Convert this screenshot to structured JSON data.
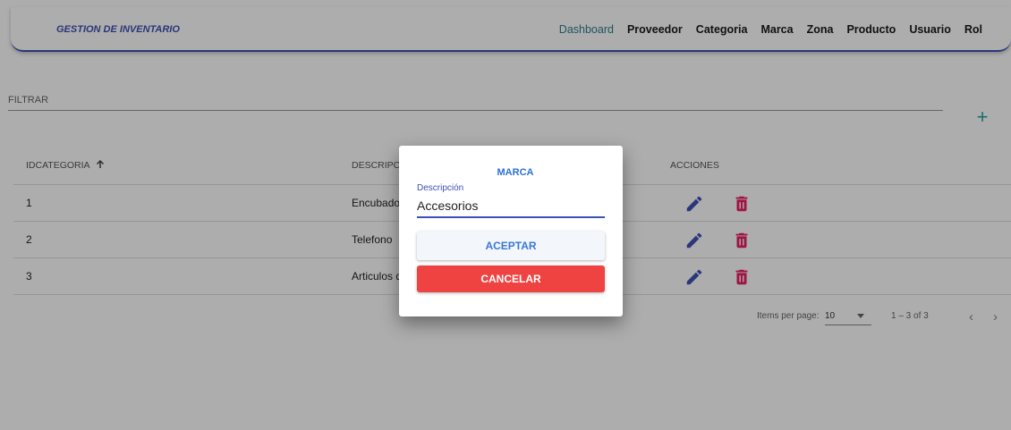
{
  "header": {
    "brand": "GESTION DE INVENTARIO",
    "nav": [
      "Dashboard",
      "Proveedor",
      "Categoria",
      "Marca",
      "Zona",
      "Producto",
      "Usuario",
      "Rol"
    ],
    "active": "Dashboard"
  },
  "filter": {
    "label": "FILTRAR"
  },
  "add_icon": "plus-icon",
  "table": {
    "columns": [
      "IDCATEGORIA",
      "DESCRIPCION",
      "ACCIONES"
    ],
    "sort_icon": "arrow-up-icon",
    "rows": [
      {
        "id": "1",
        "descripcion": "Encubado"
      },
      {
        "id": "2",
        "descripcion": "Telefono"
      },
      {
        "id": "3",
        "descripcion": "Articulos d"
      }
    ],
    "edit_icon": "pencil-icon",
    "delete_icon": "trash-icon"
  },
  "paginator": {
    "items_label": "Items per page:",
    "page_size": "10",
    "range": "1 – 3 of 3"
  },
  "dialog": {
    "title": "MARCA",
    "field_label": "Descripción",
    "field_value": "Accesorios",
    "accept_label": "ACEPTAR",
    "cancel_label": "CANCELAR"
  },
  "colors": {
    "primary": "#3f51b5",
    "accent_pink": "#e91e63",
    "cancel_red": "#ef4342",
    "add_teal": "#26a69a"
  }
}
